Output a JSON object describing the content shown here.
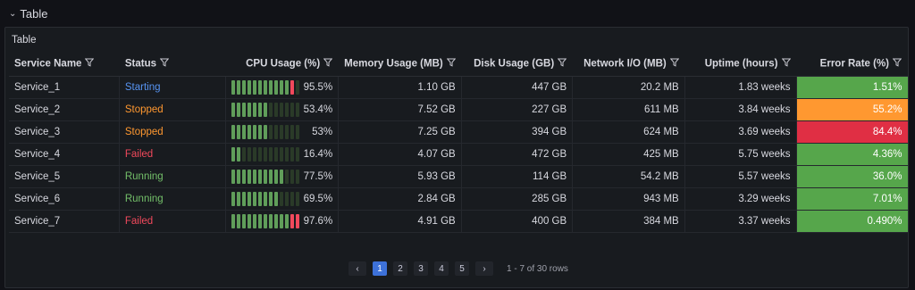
{
  "section": {
    "title": "Table"
  },
  "panel": {
    "title": "Table"
  },
  "columns": [
    {
      "key": "name",
      "label": "Service Name",
      "align": "left",
      "width": 125
    },
    {
      "key": "status",
      "label": "Status",
      "align": "left",
      "width": 124
    },
    {
      "key": "cpu",
      "label": "CPU Usage (%)",
      "align": "right",
      "width": 126
    },
    {
      "key": "mem",
      "label": "Memory Usage (MB)",
      "align": "right",
      "width": 126
    },
    {
      "key": "disk",
      "label": "Disk Usage (GB)",
      "align": "right",
      "width": 125
    },
    {
      "key": "net",
      "label": "Network I/O (MB)",
      "align": "right",
      "width": 126
    },
    {
      "key": "uptime",
      "label": "Uptime (hours)",
      "align": "right",
      "width": 126
    },
    {
      "key": "err",
      "label": "Error Rate (%)",
      "align": "right",
      "width": 126
    }
  ],
  "rows": [
    {
      "name": "Service_1",
      "status": "Starting",
      "cpu_pct": 95.5,
      "cpu": "95.5%",
      "mem": "1.10 GB",
      "disk": "447 GB",
      "net": "20.2 MB",
      "uptime": "1.83 weeks",
      "err": "1.51%",
      "err_color": "#56a64b"
    },
    {
      "name": "Service_2",
      "status": "Stopped",
      "cpu_pct": 53.4,
      "cpu": "53.4%",
      "mem": "7.52 GB",
      "disk": "227 GB",
      "net": "611 MB",
      "uptime": "3.84 weeks",
      "err": "55.2%",
      "err_color": "#ff9830"
    },
    {
      "name": "Service_3",
      "status": "Stopped",
      "cpu_pct": 53,
      "cpu": "53%",
      "mem": "7.25 GB",
      "disk": "394 GB",
      "net": "624 MB",
      "uptime": "3.69 weeks",
      "err": "84.4%",
      "err_color": "#e02f44"
    },
    {
      "name": "Service_4",
      "status": "Failed",
      "cpu_pct": 16.4,
      "cpu": "16.4%",
      "mem": "4.07 GB",
      "disk": "472 GB",
      "net": "425 MB",
      "uptime": "5.75 weeks",
      "err": "4.36%",
      "err_color": "#56a64b"
    },
    {
      "name": "Service_5",
      "status": "Running",
      "cpu_pct": 77.5,
      "cpu": "77.5%",
      "mem": "5.93 GB",
      "disk": "114 GB",
      "net": "54.2 MB",
      "uptime": "5.57 weeks",
      "err": "36.0%",
      "err_color": "#56a64b"
    },
    {
      "name": "Service_6",
      "status": "Running",
      "cpu_pct": 69.5,
      "cpu": "69.5%",
      "mem": "2.84 GB",
      "disk": "285 GB",
      "net": "943 MB",
      "uptime": "3.29 weeks",
      "err": "7.01%",
      "err_color": "#56a64b"
    },
    {
      "name": "Service_7",
      "status": "Failed",
      "cpu_pct": 97.6,
      "cpu": "97.6%",
      "mem": "4.91 GB",
      "disk": "400 GB",
      "net": "384 MB",
      "uptime": "3.37 weeks",
      "err": "0.490%",
      "err_color": "#56a64b"
    }
  ],
  "pagination": {
    "prev": "‹",
    "next": "›",
    "pages": [
      "1",
      "2",
      "3",
      "4",
      "5"
    ],
    "active_page": "1",
    "summary": "1 - 7 of 30 rows"
  },
  "icons": {
    "filter": "filter-icon",
    "collapse": "chevron-down-icon"
  },
  "colors": {
    "gauge_green": "#73bf69",
    "gauge_red": "#f2495c",
    "gauge_off": "#2a3a28",
    "accent": "#3d71d9"
  }
}
